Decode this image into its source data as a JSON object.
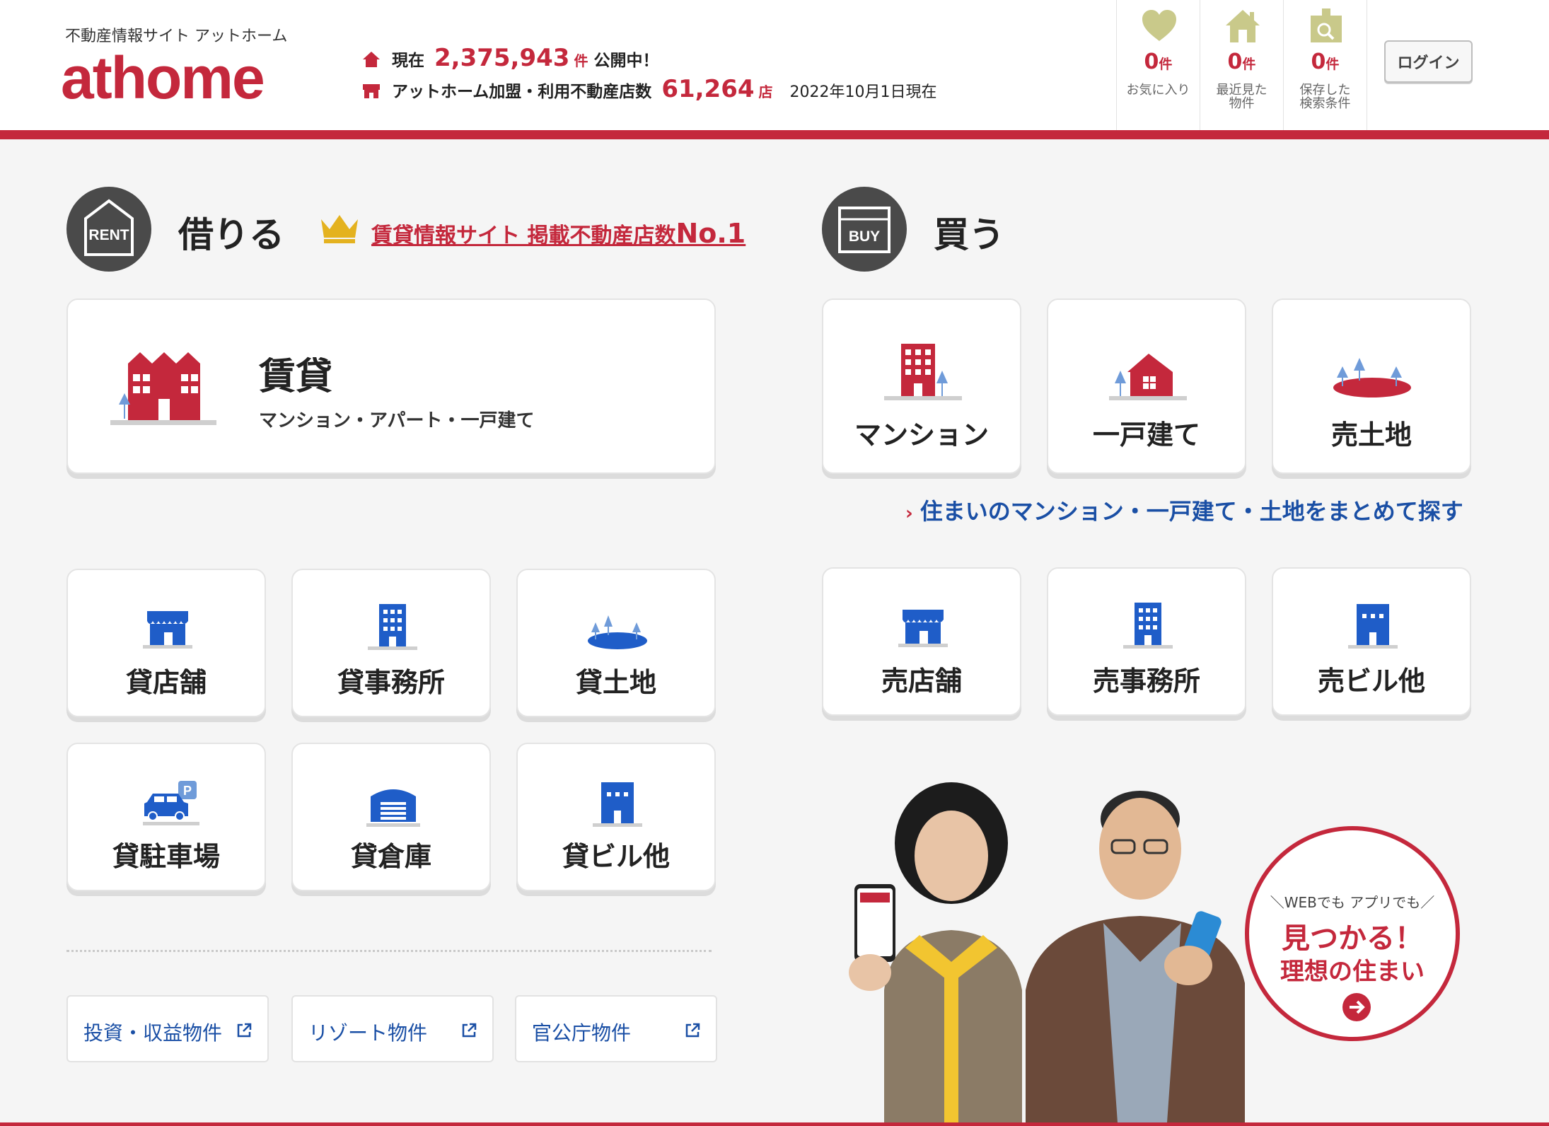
{
  "header": {
    "tagline": "不動産情報サイト アットホーム",
    "logo": "athome",
    "stats": {
      "listings_prefix": "現在",
      "listings_count": "2,375,943",
      "listings_unit": "件",
      "listings_suffix": "公開中！",
      "stores_label": "アットホーム加盟・利用不動産店数",
      "stores_count": "61,264",
      "stores_unit": "店",
      "as_of": "2022年10月1日現在"
    },
    "favorites": {
      "count": "0",
      "unit": "件",
      "label": "お気に入り",
      "icon": "heart-icon"
    },
    "recent": {
      "count": "0",
      "unit": "件",
      "label_line1": "最近見た",
      "label_line2": "物件",
      "icon": "house-icon"
    },
    "saved": {
      "count": "0",
      "unit": "件",
      "label_line1": "保存した",
      "label_line2": "検索条件",
      "icon": "saved-search-icon"
    },
    "login_label": "ログイン"
  },
  "rent": {
    "badge": "RENT",
    "title": "借りる",
    "ranking_link": "賃貸情報サイト 掲載不動産店数",
    "ranking_no1": "No.1",
    "main": {
      "title": "賃貸",
      "sub": "マンション・アパート・一戸建て"
    },
    "cards": [
      "貸店舗",
      "貸事務所",
      "貸土地",
      "貸駐車場",
      "貸倉庫",
      "貸ビル他"
    ],
    "links": [
      "投資・収益物件",
      "リゾート物件",
      "官公庁物件"
    ]
  },
  "buy": {
    "badge": "BUY",
    "title": "買う",
    "top_cards": [
      "マンション",
      "一戸建て",
      "売土地"
    ],
    "combined_link": "住まいのマンション・一戸建て・土地をまとめて探す",
    "cards": [
      "売店舗",
      "売事務所",
      "売ビル他"
    ]
  },
  "ad": {
    "small": "＼WEBでも アプリでも／",
    "line1": "見つかる！",
    "line2": "理想の住まい"
  },
  "colors": {
    "brand_red": "#c4283c",
    "link_blue": "#1a4fa5",
    "icon_blue": "#1f5dc8"
  }
}
